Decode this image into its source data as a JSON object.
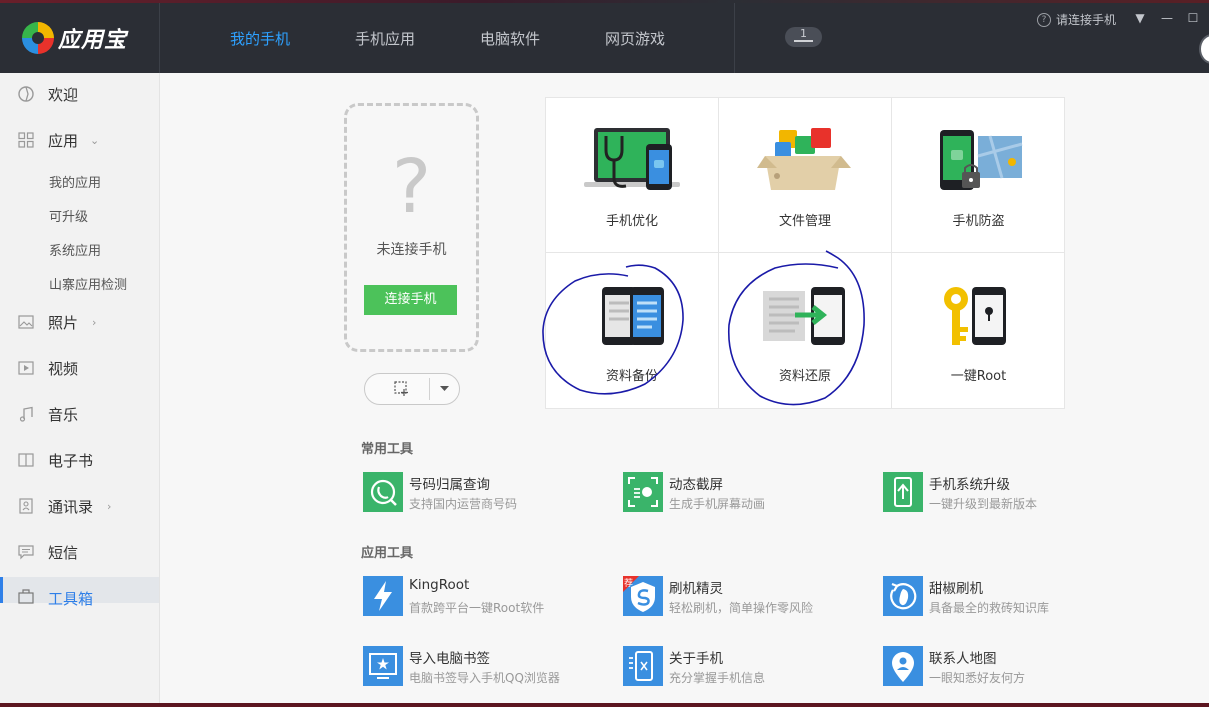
{
  "app": {
    "title": "应用宝"
  },
  "nav": {
    "tabs": [
      {
        "label": "我的手机"
      },
      {
        "label": "手机应用"
      },
      {
        "label": "电脑软件"
      },
      {
        "label": "网页游戏"
      }
    ],
    "badge": "1",
    "connect_hint": "请连接手机",
    "help": "?"
  },
  "window_controls": {
    "dropdown": "▼",
    "minimize": "—",
    "maximize": "☐"
  },
  "sidebar": {
    "items": [
      {
        "label": "欢迎",
        "icon": "welcome-icon"
      },
      {
        "label": "应用",
        "icon": "apps-grid-icon"
      },
      {
        "label": "照片",
        "icon": "photo-icon"
      },
      {
        "label": "视频",
        "icon": "video-icon"
      },
      {
        "label": "音乐",
        "icon": "music-icon"
      },
      {
        "label": "电子书",
        "icon": "ebook-icon"
      },
      {
        "label": "通讯录",
        "icon": "contacts-icon"
      },
      {
        "label": "短信",
        "icon": "sms-icon"
      },
      {
        "label": "工具箱",
        "icon": "toolbox-icon"
      }
    ],
    "sub_items": [
      {
        "label": "我的应用"
      },
      {
        "label": "可升级"
      },
      {
        "label": "系统应用"
      },
      {
        "label": "山寨应用检测"
      }
    ]
  },
  "phone": {
    "placeholder": "?",
    "status": "未连接手机",
    "connect_button": "连接手机"
  },
  "features": [
    {
      "label": "手机优化"
    },
    {
      "label": "文件管理"
    },
    {
      "label": "手机防盗"
    },
    {
      "label": "资料备份"
    },
    {
      "label": "资料还原"
    },
    {
      "label": "一键Root"
    }
  ],
  "common_tools": {
    "title": "常用工具",
    "items": [
      {
        "name": "号码归属查询",
        "desc": "支持国内运营商号码",
        "color": "#3ab46a"
      },
      {
        "name": "动态截屏",
        "desc": "生成手机屏幕动画",
        "color": "#3ab46a"
      },
      {
        "name": "手机系统升级",
        "desc": "一键升级到最新版本",
        "color": "#3ab46a"
      }
    ]
  },
  "app_tools": {
    "title": "应用工具",
    "items": [
      {
        "name": "KingRoot",
        "desc": "首款跨平台一键Root软件",
        "color": "#3a8fe0"
      },
      {
        "name": "刷机精灵",
        "desc": "轻松刷机，简单操作零风险",
        "color": "#3a8fe0",
        "tag": "荐"
      },
      {
        "name": "甜椒刷机",
        "desc": "具备最全的救砖知识库",
        "color": "#3a8fe0"
      },
      {
        "name": "导入电脑书签",
        "desc": "电脑书签导入手机QQ浏览器",
        "color": "#3a8fe0"
      },
      {
        "name": "关于手机",
        "desc": "充分掌握手机信息",
        "color": "#3a8fe0"
      },
      {
        "name": "联系人地图",
        "desc": "一眼知悉好友何方",
        "color": "#3a8fe0"
      }
    ]
  },
  "colors": {
    "accent": "#2ea1ff",
    "green": "#4cc25a",
    "header": "#2b2e35",
    "annotation": "#1a1aa8"
  }
}
